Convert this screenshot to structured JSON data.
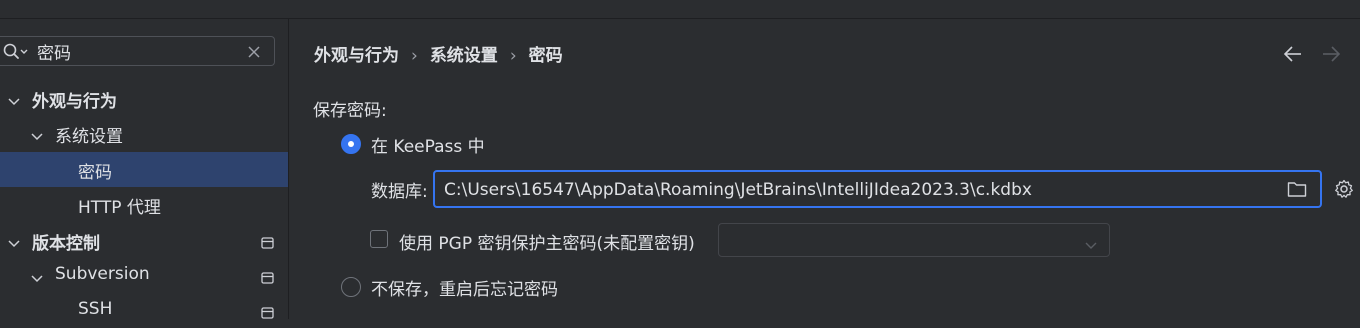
{
  "search": {
    "value": "密码",
    "placeholder": ""
  },
  "tree": {
    "items": [
      {
        "label": "外观与行为"
      },
      {
        "label": "系统设置"
      },
      {
        "label": "密码"
      },
      {
        "label": "HTTP 代理"
      },
      {
        "label": "版本控制"
      },
      {
        "label": "Subversion"
      },
      {
        "label": "SSH"
      }
    ]
  },
  "breadcrumb": [
    "外观与行为",
    "系统设置",
    "密码"
  ],
  "section": {
    "label": "保存密码:"
  },
  "options": {
    "keepass": {
      "label": "在 KeePass 中",
      "selected": true
    },
    "no_save": {
      "label": "不保存，重启后忘记密码",
      "selected": false
    }
  },
  "database": {
    "label": "数据库:",
    "value": "C:\\Users\\16547\\AppData\\Roaming\\JetBrains\\IntelliJIdea2023.3\\c.kdbx"
  },
  "pgp": {
    "label": "使用 PGP 密钥保护主密码(未配置密钥)",
    "checked": false,
    "value": ""
  },
  "icons": {
    "search": "search-icon",
    "clear": "close-icon",
    "expand": "chevron-down-icon",
    "project": "project-scope-icon",
    "back": "arrow-left-icon",
    "forward": "arrow-right-icon",
    "folder": "folder-icon",
    "gear": "gear-icon",
    "dropdown": "chevron-down-icon"
  },
  "colors": {
    "background": "#2b2d30",
    "selection": "#2e436e",
    "accent": "#3574f0",
    "text": "#dfe1e5",
    "muted": "#6f737a"
  }
}
